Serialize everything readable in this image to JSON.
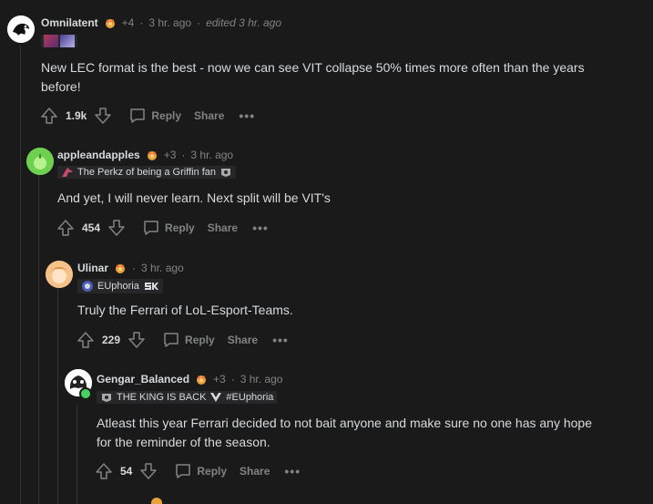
{
  "comments": [
    {
      "username": "Omnilatent",
      "award_count": "+4",
      "time": "3 hr. ago",
      "edited": "edited 3 hr. ago",
      "flair_text": "",
      "body_lines": [
        "New LEC format is the best - now we can see VIT collapse 50% times more often than the years",
        "before!"
      ],
      "score": "1.9k",
      "reply_label": "Reply",
      "share_label": "Share",
      "more_label": "•••",
      "separator": "·"
    },
    {
      "username": "appleandapples",
      "award_count": "+3",
      "time": "3 hr. ago",
      "edited": "",
      "flair_text": "The Perkz of being a Griffin fan",
      "body_lines": [
        "And yet, I will never learn. Next split will be VIT's"
      ],
      "score": "454",
      "reply_label": "Reply",
      "share_label": "Share",
      "more_label": "•••",
      "separator": "·"
    },
    {
      "username": "Ulinar",
      "award_count": "",
      "time": "3 hr. ago",
      "edited": "",
      "flair_text": "EUphoria",
      "body_lines": [
        "Truly the Ferrari of LoL-Esport-Teams."
      ],
      "score": "229",
      "reply_label": "Reply",
      "share_label": "Share",
      "more_label": "•••",
      "separator": "·"
    },
    {
      "username": "Gengar_Balanced",
      "award_count": "+3",
      "time": "3 hr. ago",
      "edited": "",
      "flair_text": "THE KING IS BACK",
      "flair_text2": "#EUphoria",
      "body_lines": [
        "Atleast this year Ferrari decided to not bait anyone and make sure no one has any hope",
        "for the reminder of the season."
      ],
      "score": "54",
      "reply_label": "Reply",
      "share_label": "Share",
      "more_label": "•••",
      "separator": "·"
    }
  ],
  "colors": {
    "background": "#1a1a1b",
    "text": "#d7dadc",
    "meta": "#818384",
    "thread_line": "#343536",
    "online_dot": "#46d160"
  },
  "icons": [
    "upvote-icon",
    "downvote-icon",
    "comment-icon",
    "award-icon",
    "more-icon"
  ]
}
